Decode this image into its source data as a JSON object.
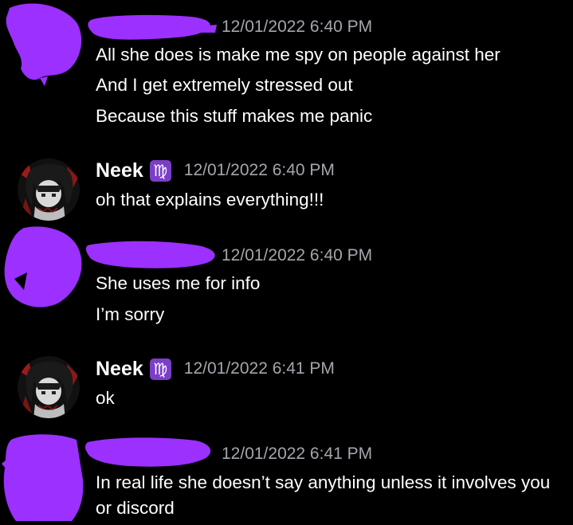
{
  "colors": {
    "background": "#000000",
    "redaction": "#9b30ff",
    "timestamp": "#a3a6ab",
    "badge": "#7b3fc7",
    "text": "#ffffff"
  },
  "messages": [
    {
      "author": "",
      "author_redacted": true,
      "timestamp": "12/01/2022 6:40 PM",
      "lines": [
        "All she does is make me spy on people against her",
        "And I get extremely stressed out",
        "Because this stuff makes me panic"
      ]
    },
    {
      "author": "Neek",
      "badge_glyph": "♍",
      "badge_icon": "virgo-icon",
      "timestamp": "12/01/2022 6:40 PM",
      "lines": [
        "oh that explains everything!!!"
      ]
    },
    {
      "author": "",
      "author_redacted": true,
      "timestamp": "12/01/2022 6:40 PM",
      "lines": [
        "She uses me for info",
        "I’m sorry"
      ]
    },
    {
      "author": "Neek",
      "badge_glyph": "♍",
      "badge_icon": "virgo-icon",
      "timestamp": "12/01/2022 6:41 PM",
      "lines": [
        "ok"
      ]
    },
    {
      "author": "",
      "author_redacted": true,
      "timestamp": "12/01/2022 6:41 PM",
      "lines": [
        "In real life she doesn’t say anything unless it involves you or discord"
      ]
    }
  ]
}
